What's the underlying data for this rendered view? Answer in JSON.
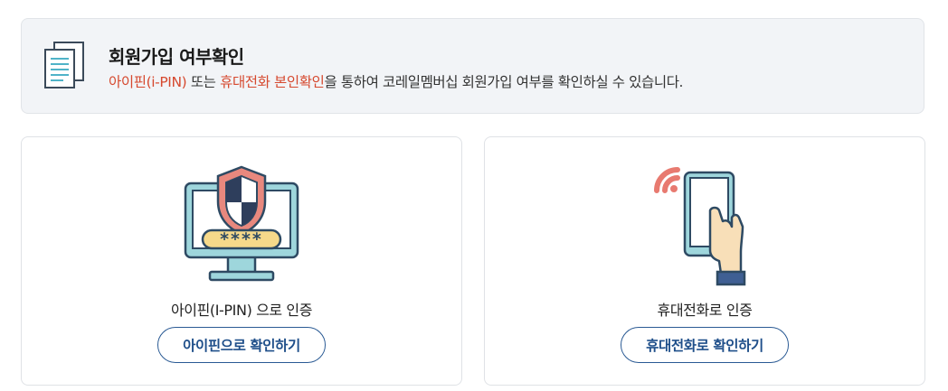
{
  "info": {
    "title": "회원가입 여부확인",
    "desc_ipin": "아이핀(i-PIN)",
    "desc_or": " 또는 ",
    "desc_phone": "휴대전화 본인확인",
    "desc_rest": "을 통하여 코레일멤버십 회원가입 여부를 확인하실 수 있습니다.",
    "icon": "document-icon"
  },
  "cards": {
    "ipin": {
      "icon": "monitor-shield-icon",
      "label": "아이핀(I-PIN) 으로 인증",
      "button": "아이핀으로 확인하기",
      "password_mask": "****"
    },
    "phone": {
      "icon": "phone-hand-icon",
      "label": "휴대전화로 인증",
      "button": "휴대전화로 확인하기"
    }
  },
  "colors": {
    "accent_red": "#d6492f",
    "button_blue": "#1f4f8a",
    "info_bg": "#f2f4f7"
  }
}
